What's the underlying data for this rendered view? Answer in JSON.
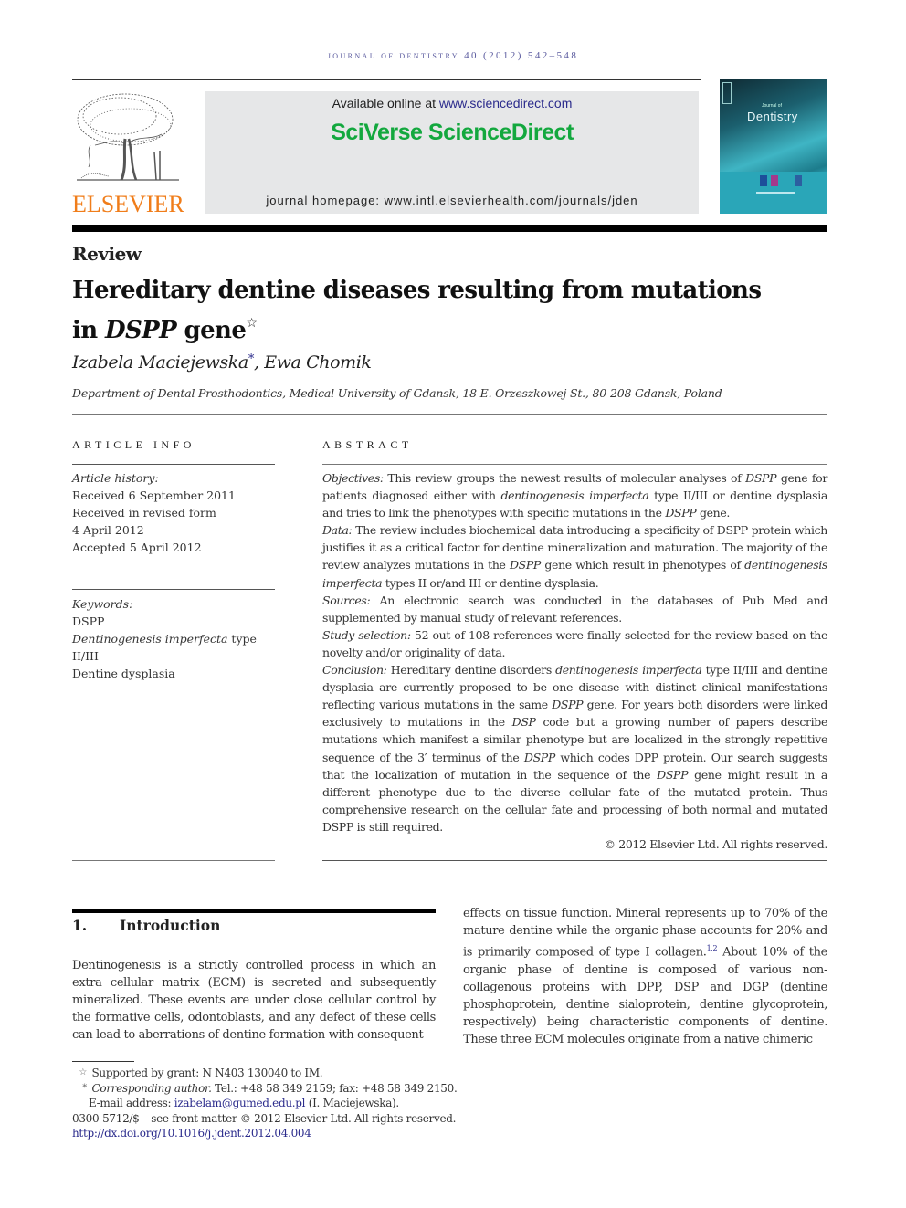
{
  "running_head": "journal of dentistry 40 (2012) 542–548",
  "masthead": {
    "publisher_logo_text": "ELSEVIER",
    "available_online_prefix": "Available online at ",
    "available_online_link": "www.sciencedirect.com",
    "platform_name": "SciVerse ScienceDirect",
    "journal_homepage": "journal homepage: www.intl.elsevierhealth.com/journals/jden",
    "cover_title": "Dentistry",
    "cover_subtitle": "Journal of",
    "colors": {
      "elsevier_orange": "#f07d1a",
      "sciencedirect_green": "#13a83e",
      "link_blue": "#2b2b8c",
      "cover_teal": "#2aa6b8",
      "masthead_box_gray": "#e6e7e8"
    }
  },
  "article": {
    "type": "Review",
    "title_line1": "Hereditary dentine diseases resulting from mutations",
    "title_line2_prefix": "in ",
    "title_line2_italic": "DSPP",
    "title_line2_suffix": " gene",
    "title_note_mark": "☆",
    "authors": [
      {
        "name": "Izabela Maciejewska",
        "mark": "*"
      },
      {
        "name": "Ewa Chomik",
        "mark": ""
      }
    ],
    "author_separator": ", ",
    "affiliation": "Department of Dental Prosthodontics, Medical University of Gdansk, 18 E. Orzeszkowej St., 80-208 Gdansk, Poland"
  },
  "article_info": {
    "heading": "ARTICLE INFO",
    "history_label": "Article history:",
    "history": [
      "Received 6 September 2011",
      "Received in revised form",
      "4 April 2012",
      "Accepted 5 April 2012"
    ],
    "keywords_label": "Keywords:",
    "keywords": [
      {
        "text": "DSPP"
      },
      {
        "italic": "Dentinogenesis imperfecta",
        "text": " type II/III"
      },
      {
        "text": "Dentine dysplasia"
      }
    ]
  },
  "abstract": {
    "heading": "ABSTRACT",
    "objectives_label": "Objectives:",
    "objectives": [
      " This review groups the newest results of molecular analyses of ",
      "DSPP",
      " gene for patients diagnosed either with ",
      "dentinogenesis imperfecta",
      " type II/III or dentine dysplasia and tries to link the phenotypes with specific mutations in the ",
      "DSPP",
      " gene."
    ],
    "data_label": "Data:",
    "data": [
      " The review includes biochemical data introducing a specificity of DSPP protein which justifies it as a critical factor for dentine mineralization and maturation. The majority of the review analyzes mutations in the ",
      "DSPP",
      " gene which result in phenotypes of ",
      "dentinogenesis imperfecta",
      " types II or/and III or dentine dysplasia."
    ],
    "sources_label": "Sources:",
    "sources": " An electronic search was conducted in the databases of Pub Med and supplemented by manual study of relevant references.",
    "study_selection_label": "Study selection:",
    "study_selection": " 52 out of 108 references were finally selected for the review based on the novelty and/or originality of data.",
    "conclusion_label": "Conclusion:",
    "conclusion": [
      " Hereditary dentine disorders ",
      "dentinogenesis imperfecta",
      " type II/III and dentine dysplasia are currently proposed to be one disease with distinct clinical manifestations reflecting various mutations in the same ",
      "DSPP",
      " gene. For years both disorders were linked exclusively to mutations in the ",
      "DSP",
      " code but a growing number of papers describe mutations which manifest a similar phenotype but are localized in the strongly repetitive sequence of the 3′ terminus of the ",
      "DSPP",
      " which codes DPP protein. Our search suggests that the localization of mutation in the sequence of the ",
      "DSPP",
      " gene might result in a different phenotype due to the diverse cellular fate of the mutated protein. Thus comprehensive research on the cellular fate and processing of both normal and mutated DSPP is still required."
    ],
    "copyright": "© 2012 Elsevier Ltd. All rights reserved."
  },
  "introduction": {
    "number": "1.",
    "heading": "Introduction",
    "para1": "Dentinogenesis is a strictly controlled process in which an extra cellular matrix (ECM) is secreted and subsequently mineralized. These events are under close cellular control by the formative cells, odontoblasts, and any defect of these cells can lead to aberrations of dentine formation with consequent",
    "para2_a": "effects on tissue function. Mineral represents up to 70% of the mature dentine while the organic phase accounts for 20% and is primarily composed of type I collagen.",
    "para2_ref": "1,2",
    "para2_b": " About 10% of the organic phase of dentine is composed of various non-collagenous proteins with DPP, DSP and DGP (dentine phosphoprotein, dentine sialoprotein, dentine glycoprotein, respectively) being characteristic components of dentine. These three ECM molecules originate from a native chimeric"
  },
  "footnotes": {
    "grant_mark": "☆",
    "grant": "Supported by grant: N N403 130040 to IM.",
    "corr_mark": "*",
    "corr_label": "Corresponding author.",
    "corr_contact": " Tel.: +48 58 349 2159; fax: +48 58 349 2150.",
    "email_prefix": "E-mail address: ",
    "email": "izabelam@gumed.edu.pl",
    "email_suffix": " (I. Maciejewska).",
    "front_matter": "0300-5712/$ – see front matter © 2012 Elsevier Ltd. All rights reserved.",
    "doi": "http://dx.doi.org/10.1016/j.jdent.2012.04.004"
  }
}
